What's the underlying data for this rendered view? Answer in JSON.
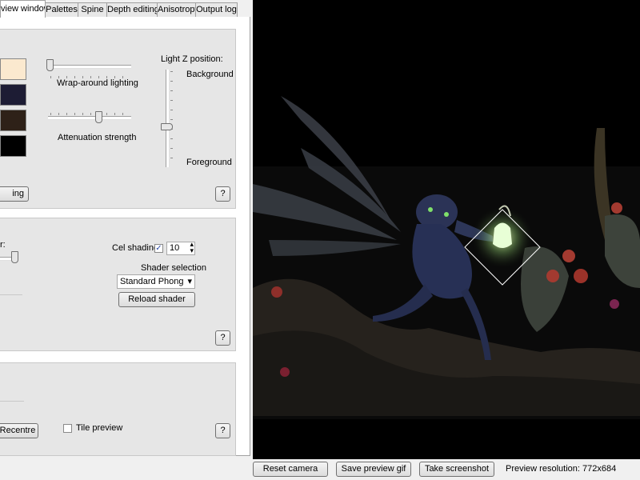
{
  "tabs": [
    {
      "label": "view window",
      "active": true
    },
    {
      "label": "Palettes"
    },
    {
      "label": "Spine"
    },
    {
      "label": "Depth editing"
    },
    {
      "label": "Anisotropy"
    },
    {
      "label": "Output log"
    }
  ],
  "lighting": {
    "swatch_colors": [
      "#fbe9cf",
      "#1d1c34",
      "#2e2118",
      "#000000"
    ],
    "wraparound_label": "Wrap-around lighting",
    "attenuation_label": "Attenuation strength",
    "light_z_label": "Light Z position:",
    "light_z_top": "Background",
    "light_z_bottom": "Foreground",
    "cut_button": "ing",
    "help": "?"
  },
  "shading": {
    "cut_label": "r:",
    "cel_label": "Cel shading",
    "cel_checked": "✓",
    "cel_value": "10",
    "shader_label": "Shader selection",
    "shader_value": "Standard Phong",
    "reload_button": "Reload shader",
    "help": "?"
  },
  "view": {
    "recentre_button": "Recentre",
    "tile_label": "Tile preview",
    "help": "?"
  },
  "bottom": {
    "reset_camera": "Reset camera",
    "save_gif": "Save preview gif",
    "screenshot": "Take screenshot",
    "resolution": "Preview resolution: 772x684"
  },
  "icons": {
    "dropdown": "▾",
    "spin_up": "▴",
    "spin_down": "▾"
  }
}
